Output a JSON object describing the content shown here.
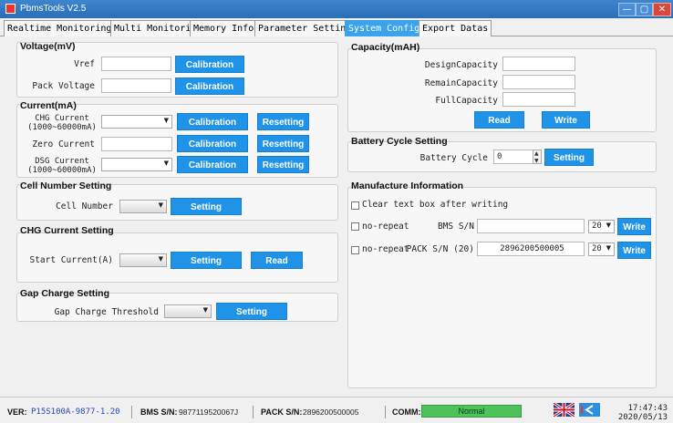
{
  "window": {
    "title": "PbmsTools V2.5",
    "controls": {
      "minimize": "—",
      "maximize": "▢",
      "close": "✕"
    }
  },
  "tabs": [
    {
      "label": "Realtime Monitoring"
    },
    {
      "label": "Multi Monitoring"
    },
    {
      "label": "Memory Info."
    },
    {
      "label": "Parameter Setting"
    },
    {
      "label": "System Config."
    },
    {
      "label": "Export Datas"
    }
  ],
  "voltage": {
    "title": "Voltage(mV)",
    "vref_label": "Vref",
    "vref_value": "",
    "pack_label": "Pack Voltage",
    "pack_value": "",
    "calibration": "Calibration"
  },
  "current": {
    "title": "Current(mA)",
    "chg_label_1": "CHG Current",
    "chg_label_2": "(1000~60000mA)",
    "zero_label": "Zero Current",
    "zero_value": "",
    "dsg_label_1": "DSG Current",
    "dsg_label_2": "(1000~60000mA)",
    "calibration": "Calibration",
    "resetting": "Resetting"
  },
  "cell": {
    "title": "Cell Number Setting",
    "label": "Cell Number",
    "setting": "Setting"
  },
  "chg_current": {
    "title": "CHG Current Setting",
    "label": "Start Current(A)",
    "setting": "Setting",
    "read": "Read"
  },
  "gap": {
    "title": "Gap Charge Setting",
    "label": "Gap Charge Threshold",
    "setting": "Setting"
  },
  "capacity": {
    "title": "Capacity(mAH)",
    "design_label": "DesignCapacity",
    "design_value": "",
    "remain_label": "RemainCapacity",
    "remain_value": "",
    "full_label": "FullCapacity",
    "full_value": "",
    "read": "Read",
    "write": "Write"
  },
  "cycle": {
    "title": "Battery Cycle Setting",
    "label": "Battery Cycle",
    "value": "0",
    "setting": "Setting"
  },
  "manufacture": {
    "title": "Manufacture Information",
    "clear_label": "Clear text box after writing",
    "norepeat_label": "no-repeat",
    "bms_label": "BMS S/N",
    "bms_value": "",
    "bms_len": "20",
    "pack_label": "PACK S/N (20)",
    "pack_value": "2896200500005",
    "pack_len": "20",
    "write": "Write"
  },
  "status": {
    "ver_label": "VER:",
    "ver_value": "P15S100A-9877-1.20",
    "bms_label": "BMS S/N:",
    "bms_value": "9877119520067J",
    "pack_label": "PACK S/N:",
    "pack_value": "2896200500005",
    "comm_label": "COMM:",
    "comm_value": "Normal",
    "time": "17:47:43",
    "date": "2020/05/13"
  },
  "colors": {
    "accent": "#1f93e8",
    "titlebar": "#2a6db4",
    "status_ok": "#4ec25a",
    "version_text": "#2746b8"
  }
}
